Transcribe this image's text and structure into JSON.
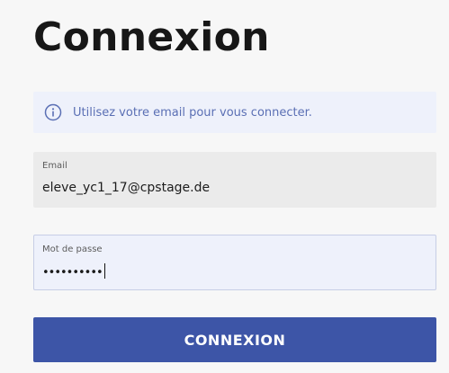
{
  "page_title": "Connexion",
  "info": {
    "icon": "info-circle-icon",
    "text": "Utilisez votre email pour vous connecter.",
    "color": "#5a6fb4"
  },
  "email": {
    "label": "Email",
    "value": "eleve_yc1_17@cpstage.de"
  },
  "password": {
    "label": "Mot de passe",
    "masked_value": "••••••••••"
  },
  "submit": {
    "label": "CONNEXION",
    "color": "#3d55a7"
  }
}
